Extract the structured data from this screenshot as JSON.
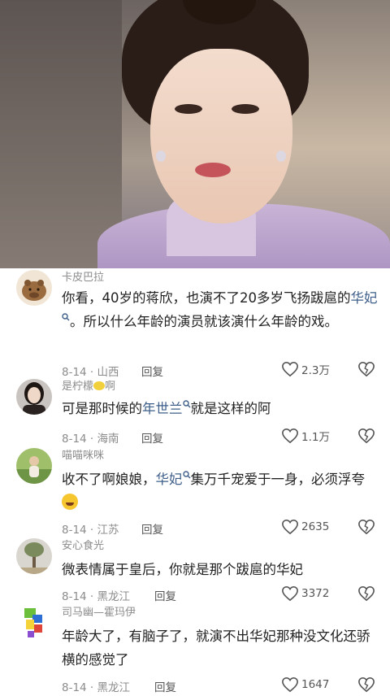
{
  "comments": [
    {
      "username": "卡皮巴拉",
      "text_before": "你看，40岁的蒋欣，也演不了20多岁飞扬跋扈的",
      "highlight": "华妃",
      "text_after": "。所以什么年龄的演员就该演什么年龄的戏。",
      "date": "8-14",
      "location": "山西",
      "reply_label": "回复",
      "likes": "2.3万"
    },
    {
      "username_prefix": "是柠檬",
      "username_suffix": "啊",
      "text_before": "可是那时候的",
      "highlight": "年世兰",
      "text_after": "就是这样的阿",
      "date": "8-14",
      "location": "海南",
      "reply_label": "回复",
      "likes": "1.1万"
    },
    {
      "username": "喵喵咪咪",
      "text_before": "收不了啊娘娘，",
      "highlight": "华妃",
      "text_after": "集万千宠爱于一身，必须浮夸",
      "date": "8-14",
      "location": "江苏",
      "reply_label": "回复",
      "likes": "2635"
    },
    {
      "username": "安心食光",
      "text": "微表情属于皇后，你就是那个跋扈的华妃",
      "date": "8-14",
      "location": "黑龙江",
      "reply_label": "回复",
      "likes": "3372"
    },
    {
      "username": "司马幽—霍玛伊",
      "text": "年龄大了，有脑子了，就演不出华妃那种没文化还骄横的感觉了",
      "date": "8-14",
      "location": "黑龙江",
      "reply_label": "回复",
      "likes": "1647"
    }
  ],
  "colors": {
    "highlight": "#3e5f8a",
    "meta": "#8c8c8c",
    "text": "#222222"
  }
}
